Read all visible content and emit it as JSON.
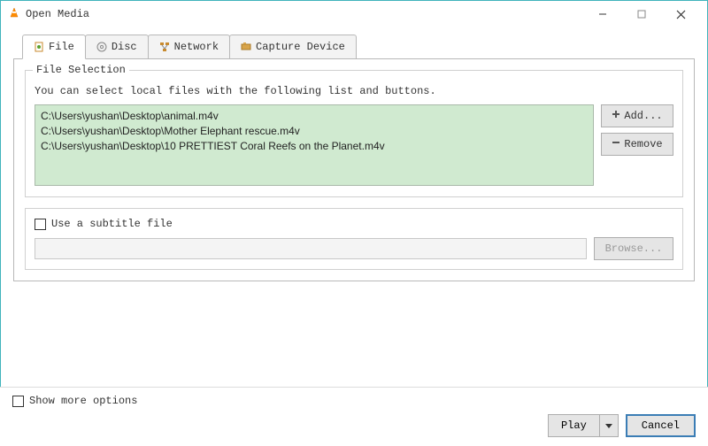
{
  "window": {
    "title": "Open Media"
  },
  "tabs": [
    {
      "label": "File"
    },
    {
      "label": "Disc"
    },
    {
      "label": "Network"
    },
    {
      "label": "Capture Device"
    }
  ],
  "file_selection": {
    "legend": "File Selection",
    "help": "You can select local files with the following list and buttons.",
    "files": [
      "C:\\Users\\yushan\\Desktop\\animal.m4v",
      "C:\\Users\\yushan\\Desktop\\Mother Elephant rescue.m4v",
      "C:\\Users\\yushan\\Desktop\\10 PRETTIEST Coral Reefs on the Planet.m4v"
    ],
    "add_label": "Add...",
    "remove_label": "Remove"
  },
  "subtitle": {
    "label": "Use a subtitle file",
    "browse_label": "Browse..."
  },
  "options": {
    "show_more_label": "Show more options"
  },
  "actions": {
    "play_label": "Play",
    "cancel_label": "Cancel"
  }
}
